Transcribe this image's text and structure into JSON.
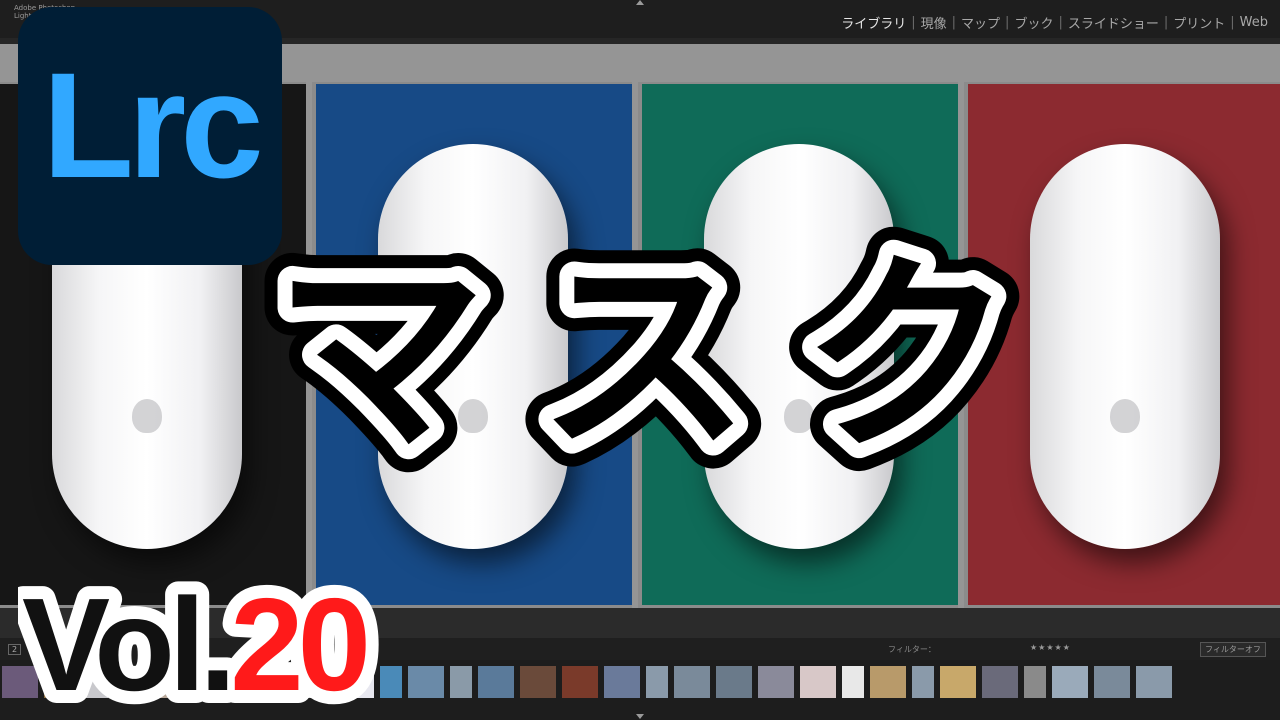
{
  "app": {
    "window_title_line1": "Adobe Photoshop",
    "window_title_line2": "Lightroom Classic"
  },
  "modules": [
    "ライブラリ",
    "現像",
    "マップ",
    "ブック",
    "スライドショー",
    "プリント",
    "Web"
  ],
  "active_module": "ライブラリ",
  "logo": {
    "text": "Lrc",
    "bg_color": "#001e36",
    "text_color": "#31a8ff"
  },
  "title": "マスク",
  "volume": {
    "prefix": "Vol.",
    "number": "20",
    "prefix_color": "#111111",
    "number_color": "#ff1a1a"
  },
  "grid_photos": [
    {
      "name": "black-mousepad",
      "bg_color": "#161616"
    },
    {
      "name": "blue-mousepad",
      "bg_color": "#174a86"
    },
    {
      "name": "green-mousepad",
      "bg_color": "#0f6b58"
    },
    {
      "name": "red-mousepad",
      "bg_color": "#8c2a30"
    }
  ],
  "filter": {
    "label": "フィルター：",
    "stars": "★★★★★",
    "preset": "フィルターオフ",
    "page_number": "2"
  },
  "filmstrip_colors": [
    "#6b5a7a",
    "#8a6a3a",
    "#c8c8cc",
    "#2a3a6a",
    "#b8a89a",
    "#9a9aa8",
    "#5a6a4a",
    "#3a4a3a",
    "#d8d8d8",
    "#e8e8f0",
    "#4a8ab8",
    "#6a8aa8",
    "#8a9aa8",
    "#5a7a9a",
    "#6a4a3a",
    "#7a3a2a",
    "#6a7a9a",
    "#8a9aaa",
    "#7a8a9a",
    "#6a7a8a",
    "#8a8a9a",
    "#d8c8c8",
    "#e8e8e8",
    "#b89a6a",
    "#8a9aaa",
    "#c8a86a",
    "#6a6a7a",
    "#8a8a8a",
    "#9aaaba",
    "#7a8a9a",
    "#8a9aaa"
  ],
  "icons": [
    "collapse-top-arrow-icon",
    "collapse-bottom-arrow-icon",
    "apple-logo-icon"
  ]
}
